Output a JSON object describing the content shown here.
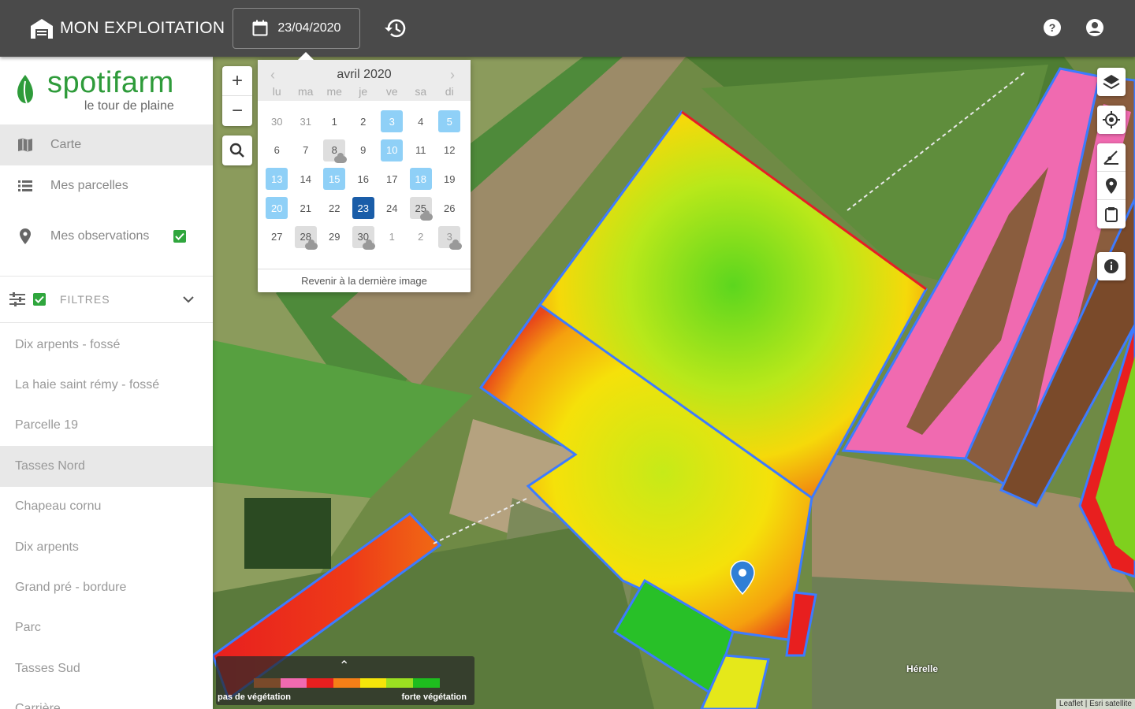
{
  "header": {
    "farm_label": "MON EXPLOITATION",
    "date_value": "23/04/2020"
  },
  "sidebar": {
    "logo_name": "spotifarm",
    "logo_tagline": "le tour de plaine",
    "nav": [
      {
        "label": "Carte"
      },
      {
        "label": "Mes parcelles"
      },
      {
        "label": "Mes observations"
      }
    ],
    "filters_label": "FILTRES",
    "parcels": [
      "Dix arpents - fossé",
      "La haie saint rémy - fossé",
      "Parcelle 19",
      "Tasses Nord",
      "Chapeau cornu",
      "Dix arpents",
      "Grand pré - bordure",
      "Parc",
      "Tasses Sud",
      "Carrière"
    ],
    "selected_parcel": "Tasses Nord"
  },
  "calendar": {
    "month_label": "avril 2020",
    "prev_label": "‹",
    "next_label": "›",
    "weekdays": [
      "lu",
      "ma",
      "me",
      "je",
      "ve",
      "sa",
      "di"
    ],
    "weeks": [
      [
        {
          "d": "30",
          "other": true
        },
        {
          "d": "31",
          "other": true
        },
        {
          "d": "1"
        },
        {
          "d": "2"
        },
        {
          "d": "3",
          "state": "img"
        },
        {
          "d": "4"
        },
        {
          "d": "5",
          "state": "img"
        }
      ],
      [
        {
          "d": "6"
        },
        {
          "d": "7"
        },
        {
          "d": "8",
          "state": "cloudy",
          "cloud": true
        },
        {
          "d": "9"
        },
        {
          "d": "10",
          "state": "img"
        },
        {
          "d": "11"
        },
        {
          "d": "12"
        }
      ],
      [
        {
          "d": "13",
          "state": "img"
        },
        {
          "d": "14"
        },
        {
          "d": "15",
          "state": "img"
        },
        {
          "d": "16"
        },
        {
          "d": "17"
        },
        {
          "d": "18",
          "state": "img"
        },
        {
          "d": "19"
        }
      ],
      [
        {
          "d": "20",
          "state": "img"
        },
        {
          "d": "21"
        },
        {
          "d": "22"
        },
        {
          "d": "23",
          "state": "selected"
        },
        {
          "d": "24"
        },
        {
          "d": "25",
          "state": "cloudy",
          "cloud": true
        },
        {
          "d": "26"
        }
      ],
      [
        {
          "d": "27"
        },
        {
          "d": "28",
          "state": "cloudy",
          "cloud": true
        },
        {
          "d": "29"
        },
        {
          "d": "30",
          "state": "cloudy",
          "cloud": true
        },
        {
          "d": "1",
          "other": true
        },
        {
          "d": "2",
          "other": true
        },
        {
          "d": "3",
          "other": true,
          "state": "cloudy",
          "cloud": true
        }
      ]
    ],
    "footer_label": "Revenir à la dernière image"
  },
  "map": {
    "zoom_in": "+",
    "zoom_out": "−",
    "village_label": "Hérelle",
    "attribution": "Leaflet | Esri satellite"
  },
  "legend": {
    "toggle": "⌃",
    "low_label": "pas de végétation",
    "high_label": "forte végétation",
    "colors": [
      "#7a4a2a",
      "#f06ab0",
      "#e81f1f",
      "#f57f17",
      "#f5e50a",
      "#9be021",
      "#1ebd1e"
    ]
  },
  "colors": {
    "topbar": "#4a4a4a",
    "brand_green": "#2e9b3a",
    "selected_day": "#1a5da8",
    "image_day": "#8fd0f7",
    "parcel_outline": "#3d7bff"
  }
}
